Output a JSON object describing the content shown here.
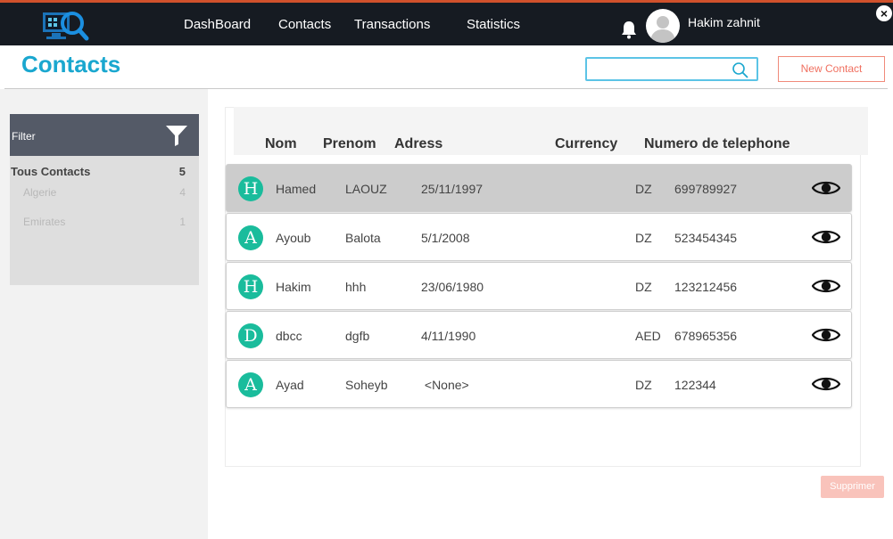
{
  "nav": {
    "items": [
      "DashBoard",
      "Contacts",
      "Transactions",
      "Statistics"
    ],
    "user_name": "Hakim zahnit",
    "close_label": "×"
  },
  "page": {
    "title": "Contacts",
    "search_value": "",
    "new_contact_label": "New Contact",
    "delete_label": "Supprimer"
  },
  "filter": {
    "label": "Filter",
    "all": {
      "label": "Tous Contacts",
      "count": "5"
    },
    "categories": [
      {
        "label": "Algerie",
        "count": "4"
      },
      {
        "label": "Emirates",
        "count": "1"
      }
    ]
  },
  "table": {
    "columns": [
      "Nom",
      "Prenom",
      "Adress",
      "Currency",
      "Numero de telephone"
    ],
    "rows": [
      {
        "initial": "H",
        "nom": "Hamed",
        "prenom": "LAOUZ",
        "date": "25/11/1997",
        "currency": "DZ",
        "phone": "699789927"
      },
      {
        "initial": "A",
        "nom": "Ayoub",
        "prenom": "Balota",
        "date": "5/1/2008",
        "currency": "DZ",
        "phone": "523454345"
      },
      {
        "initial": "H",
        "nom": "Hakim",
        "prenom": "hhh",
        "date": "23/06/1980",
        "currency": "DZ",
        "phone": "123212456"
      },
      {
        "initial": "D",
        "nom": "dbcc",
        "prenom": "dgfb",
        "date": "4/11/1990",
        "currency": "AED",
        "phone": "678965356"
      },
      {
        "initial": "A",
        "nom": "Ayad",
        "prenom": "Soheyb",
        "date": " <None>",
        "currency": "DZ",
        "phone": "122344"
      }
    ]
  },
  "colors": {
    "topbar": "#161b22",
    "accent_title": "#1aa7cf",
    "badge": "#1abc9c",
    "new_contact": "#f07060",
    "filter_header": "#545a67",
    "selected_row": "#cccccc"
  }
}
